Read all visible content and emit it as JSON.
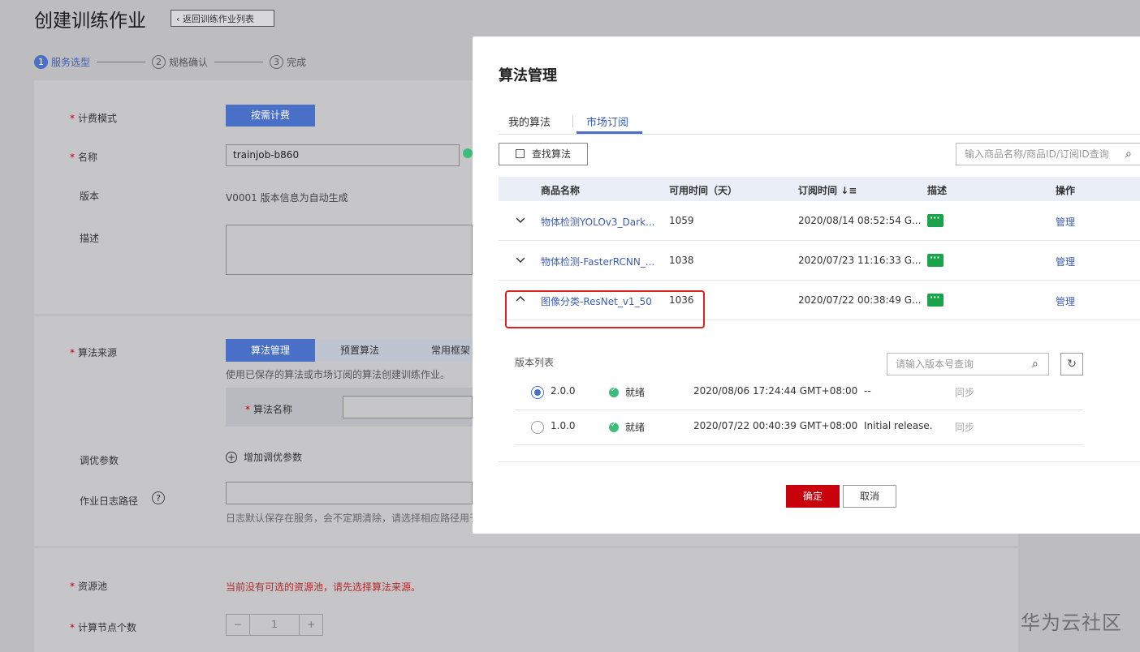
{
  "page": {
    "title": "创建训练作业",
    "back_label": "返回训练作业列表",
    "steps": [
      {
        "num": "1",
        "label": "服务选型"
      },
      {
        "num": "2",
        "label": "规格确认"
      },
      {
        "num": "3",
        "label": "完成"
      }
    ]
  },
  "form": {
    "billing_label": "计费模式",
    "billing_value": "按需计费",
    "name_label": "名称",
    "name_value": "trainjob-b860",
    "version_label": "版本",
    "version_value": "V0001 版本信息为自动生成",
    "desc_label": "描述",
    "algo_source_label": "算法来源",
    "algo_tabs": [
      "算法管理",
      "预置算法",
      "常用框架"
    ],
    "algo_hint": "使用已保存的算法或市场订阅的算法创建训练作业。",
    "algo_name_label": "算法名称",
    "tune_label": "调优参数",
    "tune_add": "增加调优参数",
    "log_label": "作业日志路径",
    "log_help": "?",
    "log_hint": "日志默认保存在服务，会不定期清除，请选择相应路径用于",
    "pool_label": "资源池",
    "pool_warning": "当前没有可选的资源池，请先选择算法来源。",
    "nodes_label": "计算节点个数",
    "nodes_minus": "−",
    "nodes_value": "1",
    "nodes_plus": "+"
  },
  "modal": {
    "title": "算法管理",
    "tabs": [
      "我的算法",
      "市场订阅"
    ],
    "active_tab": "市场订阅",
    "find_button": "查找算法",
    "search_placeholder": "输入商品名称/商品ID/订阅ID查询",
    "columns": [
      "商品名称",
      "可用时间（天）",
      "订阅时间",
      "描述",
      "操作"
    ],
    "rows": [
      {
        "name": "物体检测YOLOv3_Dark...",
        "days": "1059",
        "time": "2020/08/14 08:52:54 G...",
        "action": "管理",
        "expanded": false
      },
      {
        "name": "物体检测-FasterRCNN_...",
        "days": "1038",
        "time": "2020/07/23 11:16:33 G...",
        "action": "管理",
        "expanded": false
      },
      {
        "name": "图像分类-ResNet_v1_50",
        "days": "1036",
        "time": "2020/07/22 00:38:49 G...",
        "action": "管理",
        "expanded": true
      }
    ],
    "version_list_title": "版本列表",
    "version_search_placeholder": "请输入版本号查询",
    "versions": [
      {
        "version": "2.0.0",
        "status": "就绪",
        "time": "2020/08/06 17:24:44 GMT+08:00",
        "desc": "--",
        "sync": "同步",
        "selected": true
      },
      {
        "version": "1.0.0",
        "status": "就绪",
        "time": "2020/07/22 00:40:39 GMT+08:00",
        "desc": "Initial release.",
        "sync": "同步",
        "selected": false
      }
    ],
    "ok_button": "确定",
    "cancel_button": "取消"
  },
  "watermark": "华为云社区",
  "colors": {
    "accent": "#4a6fc7",
    "danger": "#c7000b",
    "status_ok": "#3ebd7a",
    "message_icon": "#1aa34a"
  }
}
